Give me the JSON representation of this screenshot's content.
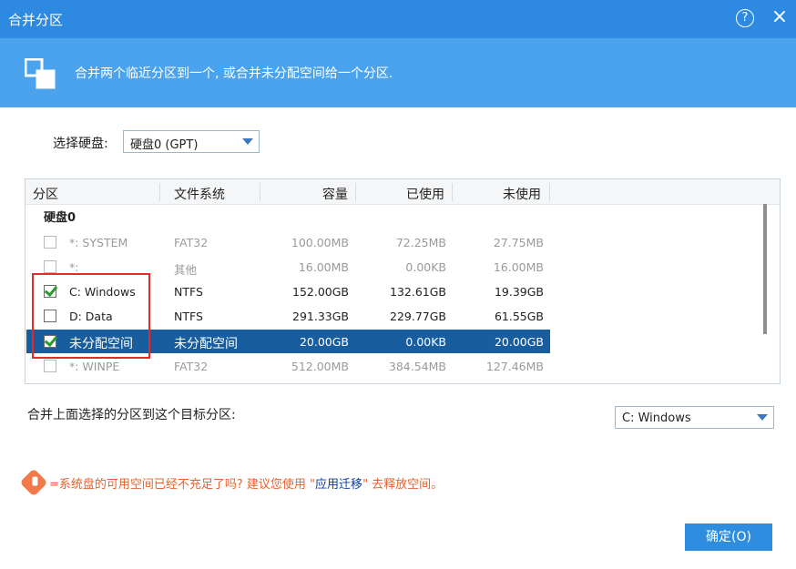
{
  "window": {
    "title": "合并分区",
    "help_label": "?",
    "close_label": "×"
  },
  "banner": {
    "icon": "merge-partitions-icon",
    "description": "合并两个临近分区到一个, 或合并未分配空间给一个分区."
  },
  "disk_select": {
    "label": "选择硬盘:",
    "value": "硬盘0 (GPT)"
  },
  "table": {
    "headers": {
      "partition": "分区",
      "filesystem": "文件系统",
      "capacity": "容量",
      "used": "已使用",
      "unused": "未使用"
    },
    "group_label": "硬盘0",
    "rows": [
      {
        "name": "*: SYSTEM",
        "fs": "FAT32",
        "capacity": "100.00MB",
        "used": "72.25MB",
        "unused": "27.75MB",
        "checked": false,
        "enabled": false,
        "selected": false
      },
      {
        "name": "*:",
        "fs": "其他",
        "capacity": "16.00MB",
        "used": "0.00KB",
        "unused": "16.00MB",
        "checked": false,
        "enabled": false,
        "selected": false
      },
      {
        "name": "C: Windows",
        "fs": "NTFS",
        "capacity": "152.00GB",
        "used": "132.61GB",
        "unused": "19.39GB",
        "checked": true,
        "enabled": true,
        "selected": false
      },
      {
        "name": "D: Data",
        "fs": "NTFS",
        "capacity": "291.33GB",
        "used": "229.77GB",
        "unused": "61.55GB",
        "checked": false,
        "enabled": true,
        "selected": false
      },
      {
        "name": "未分配空间",
        "fs": "未分配空间",
        "capacity": "20.00GB",
        "used": "0.00KB",
        "unused": "20.00GB",
        "checked": true,
        "enabled": true,
        "selected": true
      },
      {
        "name": "*: WINPE",
        "fs": "FAT32",
        "capacity": "512.00MB",
        "used": "384.54MB",
        "unused": "127.46MB",
        "checked": false,
        "enabled": false,
        "selected": false
      }
    ]
  },
  "target": {
    "label": "合并上面选择的分区到这个目标分区:",
    "value": "C: Windows"
  },
  "warning": {
    "icon": "warning-badge-icon",
    "text_before": "=系统盘的可用空间已经不充足了吗? 建议您使用 \"",
    "link": "应用迁移",
    "text_after": "\" 去释放空间。"
  },
  "ok_button": "确定(O)",
  "colors": {
    "title_bar": "#2d8ae0",
    "banner": "#4aa3ec",
    "selected_row": "#185d9e",
    "highlight_box": "#e42b2b",
    "warning_text": "#e8612c",
    "link": "#0b3ea8"
  }
}
